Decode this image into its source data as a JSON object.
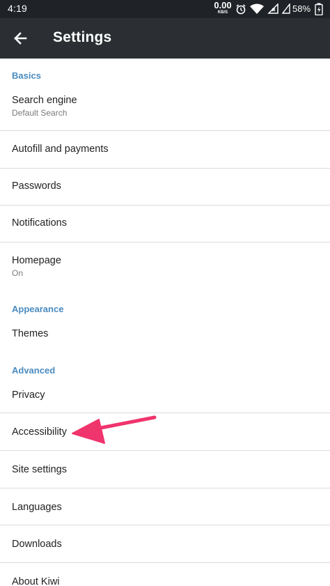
{
  "status_bar": {
    "time": "4:19",
    "net_speed_value": "0.00",
    "net_speed_unit": "KB/S",
    "battery_percent": "58%",
    "icons": [
      "alarm-icon",
      "wifi-icon",
      "signal-icon",
      "battery-icon"
    ]
  },
  "toolbar": {
    "back_icon": "arrow-left-icon",
    "title": "Settings"
  },
  "sections": {
    "basics": "Basics",
    "appearance": "Appearance",
    "advanced": "Advanced"
  },
  "items": {
    "search_engine": {
      "label": "Search engine",
      "sub": "Default Search"
    },
    "autofill": {
      "label": "Autofill and payments"
    },
    "passwords": {
      "label": "Passwords"
    },
    "notifications": {
      "label": "Notifications"
    },
    "homepage": {
      "label": "Homepage",
      "sub": "On"
    },
    "themes": {
      "label": "Themes"
    },
    "privacy": {
      "label": "Privacy"
    },
    "accessibility": {
      "label": "Accessibility"
    },
    "site_settings": {
      "label": "Site settings"
    },
    "languages": {
      "label": "Languages"
    },
    "downloads": {
      "label": "Downloads"
    },
    "about": {
      "label": "About Kiwi"
    }
  },
  "colors": {
    "status_bar": "#1f2327",
    "toolbar": "#2b2f33",
    "section_header": "#4a8bc0",
    "annotation_arrow": "#f0346c"
  }
}
